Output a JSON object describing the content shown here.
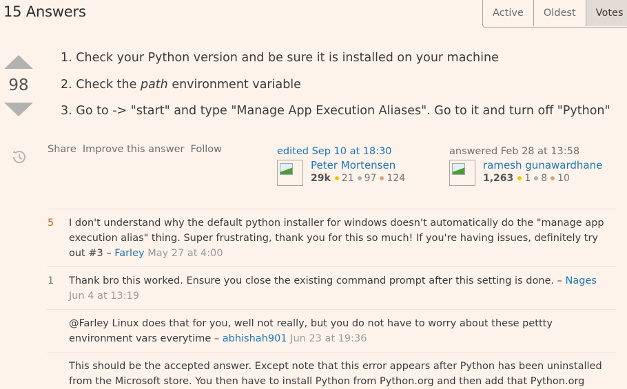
{
  "header": {
    "answers_title": "15 Answers",
    "sort_tabs": [
      {
        "label": "Active",
        "active": false
      },
      {
        "label": "Oldest",
        "active": false
      },
      {
        "label": "Votes",
        "active": true
      }
    ]
  },
  "answer": {
    "vote_count": "98",
    "steps": [
      {
        "number": "1.",
        "text": "Check your Python version and be sure it is installed on your machine"
      },
      {
        "number": "2.",
        "pre": "Check the ",
        "emphasis": "path",
        "post": " environment variable"
      },
      {
        "number": "3.",
        "text": "Go to -> \"start\" and type \"Manage App Execution Aliases\". Go to it and turn off \"Python\""
      }
    ],
    "post_menu": {
      "share": "Share",
      "improve": "Improve this answer",
      "follow": "Follow"
    },
    "editor": {
      "action": "edited Sep 10 at 18:30",
      "name": "Peter Mortensen",
      "reputation": "29k",
      "gold": "21",
      "silver": "97",
      "bronze": "124"
    },
    "author": {
      "action": "answered Feb 28 at 13:58",
      "name": "ramesh gunawardhane",
      "reputation": "1,263",
      "gold": "1",
      "silver": "8",
      "bronze": "10"
    }
  },
  "colors": {
    "background": "#fdf3ea",
    "link": "#1f75b9",
    "hot_score": "#c4651d",
    "gold": "#f6c100",
    "silver": "#afaeac",
    "bronze": "#d1a584"
  },
  "comments": [
    {
      "score": "5",
      "text": "I don't understand why the default python installer for windows doesn't automatically do the \"manage app execution alias\" thing. Super frustrating, thank you for this so much! If you're having issues, definitely try out #3",
      "author": "Farley",
      "date": "May 27 at 4:00"
    },
    {
      "score": "1",
      "text": "Thank bro this worked. Ensure you close the existing command prompt after this setting is done.",
      "author": "Nages",
      "date": "Jun 4 at 13:19"
    },
    {
      "score": "",
      "text": "@Farley Linux does that for you, well not really, but you do not have to worry about these pettty environment vars everytime",
      "author": "abhishah901",
      "date": "Jun 23 at 19:36"
    },
    {
      "score": "",
      "text": "This should be the accepted answer. Except note that this error appears after Python has been uninstalled from the Microsoft store. You then have to install Python from Python.org and then add that Python.org",
      "author": "",
      "date": ""
    }
  ]
}
